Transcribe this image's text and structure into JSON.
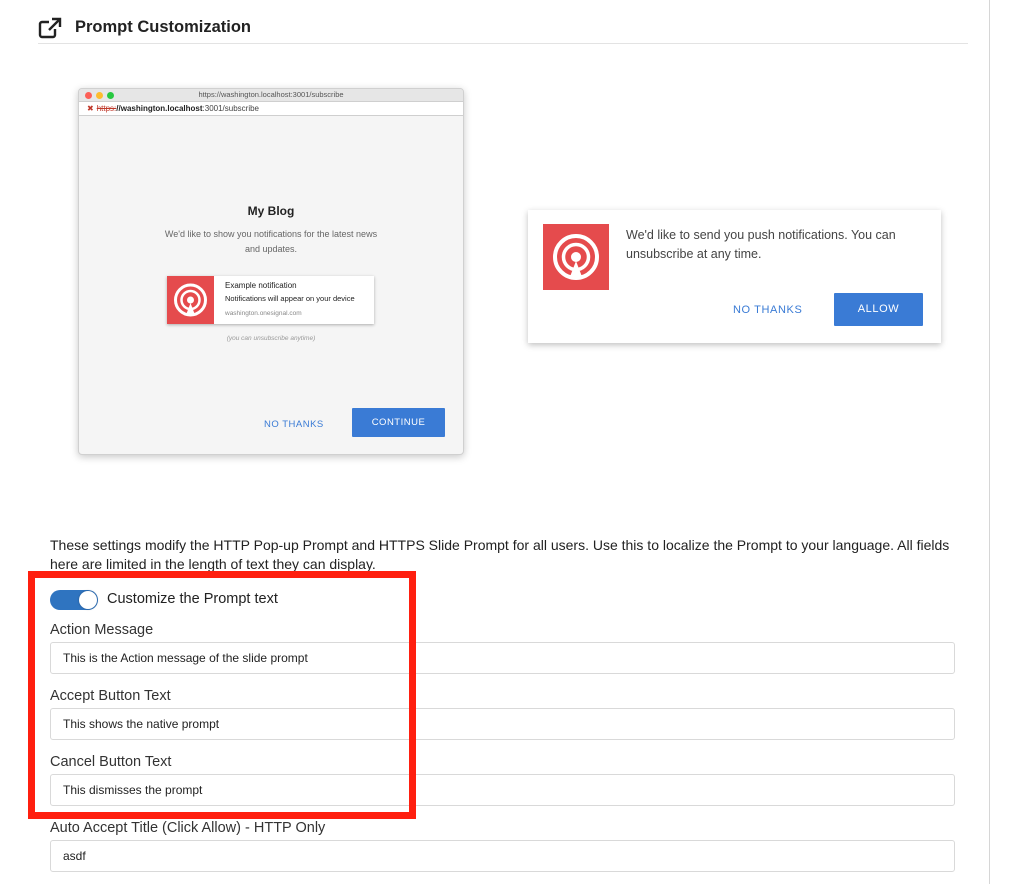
{
  "section": {
    "icon": "external-link-icon",
    "title": "Prompt Customization"
  },
  "browser_preview": {
    "title_bar": "https://washington.localhost:3001/subscribe",
    "address_scheme": "https:",
    "address_host": "//washington.localhost",
    "address_path": ":3001/subscribe",
    "blog_title": "My Blog",
    "blog_description": "We'd like to show you notifications for the latest news and updates.",
    "notification": {
      "heading": "Example notification",
      "body": "Notifications will appear on your device",
      "site": "washington.onesignal.com"
    },
    "unsubscribe_note": "(you can unsubscribe anytime)",
    "no_thanks_label": "NO THANKS",
    "continue_label": "CONTINUE"
  },
  "slide_preview": {
    "message": "We'd like to send you push notifications. You can unsubscribe at any time.",
    "no_thanks_label": "NO THANKS",
    "allow_label": "ALLOW"
  },
  "description": "These settings modify the HTTP Pop-up Prompt and HTTPS Slide Prompt for all users. Use this to localize the Prompt to your language. All fields here are limited in the length of text they can display.",
  "toggle": {
    "label": "Customize the Prompt text",
    "enabled": true
  },
  "fields": {
    "action_message": {
      "label": "Action Message",
      "value": "This is the Action message of the slide prompt"
    },
    "accept_button": {
      "label": "Accept Button Text",
      "value": "This shows the native prompt"
    },
    "cancel_button": {
      "label": "Cancel Button Text",
      "value": "This dismisses the prompt"
    },
    "auto_accept_title": {
      "label": "Auto Accept Title (Click Allow) - HTTP Only",
      "value": "asdf"
    }
  },
  "colors": {
    "accent": "#3a7bd5",
    "brand_red": "#e54b4d",
    "toggle_on": "#2f74c0",
    "highlight": "#ff1f0f"
  }
}
